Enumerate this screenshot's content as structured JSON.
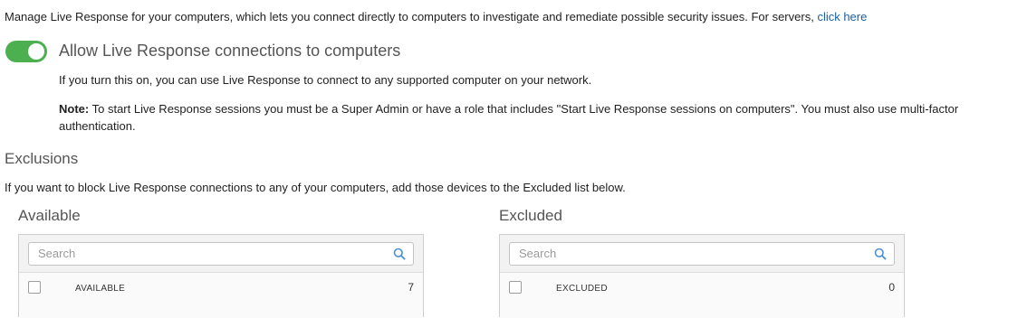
{
  "intro": {
    "text": "Manage Live Response for your computers, which lets you connect directly to computers to investigate and remediate possible security issues. For servers,",
    "link": "click here"
  },
  "toggle": {
    "label": "Allow Live Response connections to computers",
    "state": "on",
    "color": "#4caf50"
  },
  "description": "If you turn this on, you can use Live Response to connect to any supported computer on your network.",
  "note": {
    "label": "Note:",
    "text": "To start Live Response sessions you must be a Super Admin or have a role that includes \"Start Live Response sessions on computers\". You must also use multi-factor authentication."
  },
  "exclusions": {
    "title": "Exclusions",
    "description": "If you want to block Live Response connections to any of your computers, add those devices to the Excluded list below."
  },
  "available": {
    "title": "Available",
    "search_placeholder": "Search",
    "header_label": "AVAILABLE",
    "count": "7"
  },
  "excluded": {
    "title": "Excluded",
    "search_placeholder": "Search",
    "header_label": "EXCLUDED",
    "count": "0"
  },
  "icons": {
    "search": "search-icon"
  },
  "colors": {
    "link": "#1b5fa8",
    "search_icon": "#4a90d9"
  }
}
